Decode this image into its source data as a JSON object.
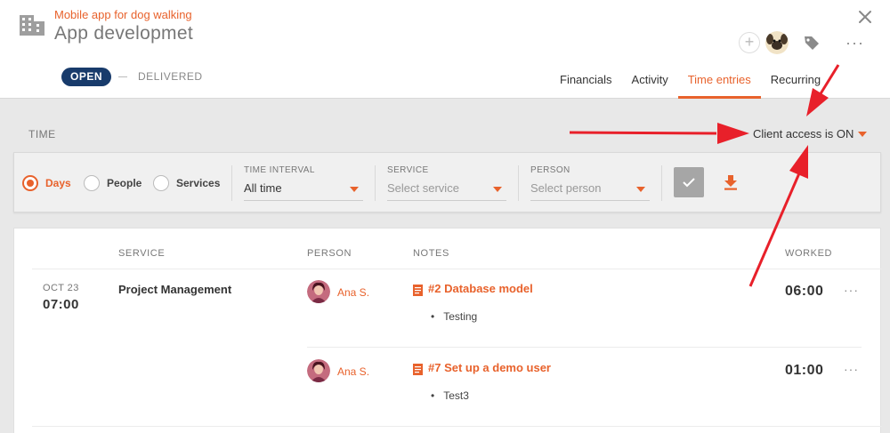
{
  "header": {
    "subtitle": "Mobile app for dog walking",
    "title": "App developmet",
    "status_open": "OPEN",
    "status_delivered": "DELIVERED",
    "add_label": "+",
    "more_label": "···"
  },
  "tabs": [
    {
      "label": "Financials",
      "active": false
    },
    {
      "label": "Activity",
      "active": false
    },
    {
      "label": "Time entries",
      "active": true
    },
    {
      "label": "Recurring",
      "active": false
    }
  ],
  "time_bar": {
    "label": "TIME",
    "client_access": "Client access is ON"
  },
  "filter": {
    "radios": [
      {
        "label": "Days",
        "checked": true
      },
      {
        "label": "People",
        "checked": false
      },
      {
        "label": "Services",
        "checked": false
      }
    ],
    "time_interval": {
      "label": "TIME INTERVAL",
      "value": "All time"
    },
    "service": {
      "label": "SERVICE",
      "placeholder": "Select service"
    },
    "person": {
      "label": "PERSON",
      "placeholder": "Select person"
    }
  },
  "table": {
    "columns": [
      "SERVICE",
      "PERSON",
      "NOTES",
      "WORKED"
    ],
    "group": {
      "date_month": "OCT 23",
      "date_time": "07:00",
      "service": "Project Management"
    },
    "entries": [
      {
        "person": "Ana S.",
        "note_title": "#2 Database model",
        "note_bullet": "Testing",
        "worked": "06:00"
      },
      {
        "person": "Ana S.",
        "note_title": "#7 Set up a demo user",
        "note_bullet": "Test3",
        "worked": "01:00"
      }
    ],
    "more_label": "···"
  },
  "colors": {
    "accent": "#e8622c",
    "navy": "#183b6b",
    "arrow": "#e8202a"
  }
}
